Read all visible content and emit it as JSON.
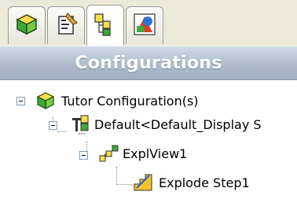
{
  "tabs": [
    {
      "icon": "feature-manager-icon"
    },
    {
      "icon": "property-manager-icon"
    },
    {
      "icon": "configuration-manager-icon",
      "active": true
    },
    {
      "icon": "display-manager-icon"
    }
  ],
  "header": {
    "title": "Configurations"
  },
  "tree": {
    "root_label": "Tutor Configuration(s)",
    "default_label": "Default<Default_Display S",
    "explview_label": "ExplView1",
    "explode_step_label": "Explode Step1"
  },
  "colors": {
    "header_bg": "#aebccd",
    "header_text": "#ffffff",
    "tab_bg": "#ece9d8"
  }
}
